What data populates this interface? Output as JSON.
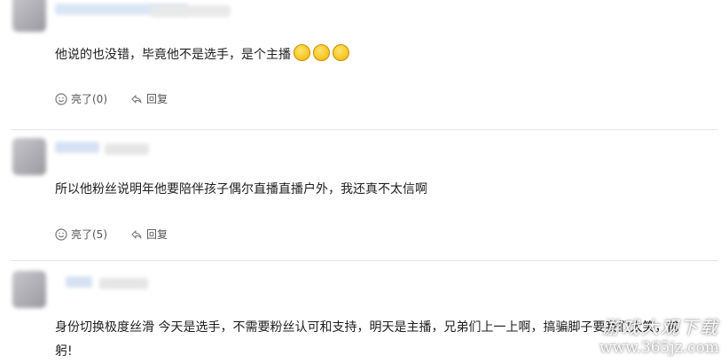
{
  "comments": [
    {
      "text": "他说的也没错，毕竟他不是选手，是个主播",
      "emoji_count": 3,
      "like_label": "亮了(0)",
      "reply_label": "回复"
    },
    {
      "text": "所以他粉丝说明年他要陪伴孩子偶尔直播直播户外，我还真不太信啊",
      "like_label": "亮了(5)",
      "reply_label": "回复"
    },
    {
      "text_line1": "身份切换极度丝滑 今天是选手，不需要粉丝认可和支持，明天是主播，兄弟们上一上啊，搞骗脚子要我们太笑，前",
      "text_line2": "躬!"
    }
  ],
  "watermark": {
    "cn": "游戏大观下载",
    "url": "www.365jz.com"
  },
  "icons": {
    "like": "smile-icon",
    "reply": "reply-arrow-icon",
    "emoji": "thinking-face-emoji"
  }
}
